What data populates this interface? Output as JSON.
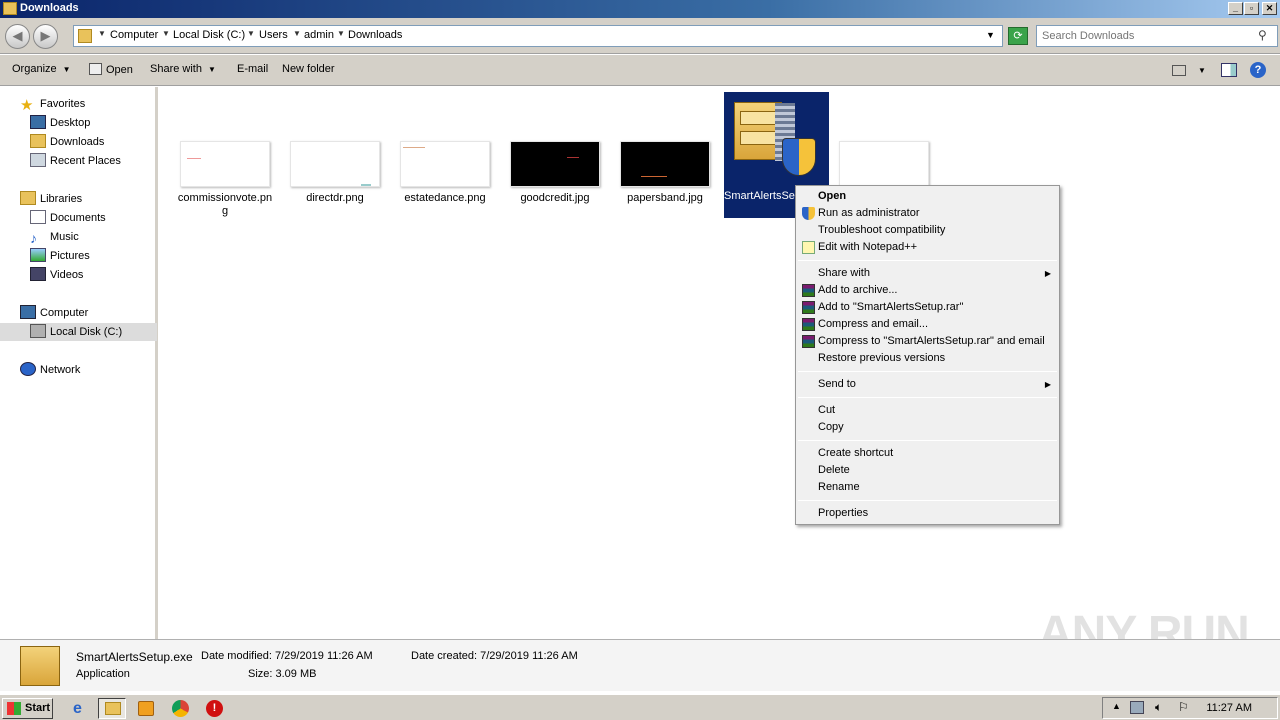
{
  "window": {
    "title": "Downloads"
  },
  "address": {
    "crumbs": [
      "Computer",
      "Local Disk (C:)",
      "Users",
      "admin",
      "Downloads"
    ],
    "search_placeholder": "Search Downloads"
  },
  "toolbar": {
    "organize": "Organize",
    "open": "Open",
    "share_with": "Share with",
    "email": "E-mail",
    "new_folder": "New folder"
  },
  "nav": {
    "favorites": "Favorites",
    "desktop": "Desktop",
    "downloads": "Downloads",
    "recent_places": "Recent Places",
    "libraries": "Libraries",
    "documents": "Documents",
    "music": "Music",
    "pictures": "Pictures",
    "videos": "Videos",
    "computer": "Computer",
    "local_disk": "Local Disk (C:)",
    "network": "Network"
  },
  "files": [
    {
      "name": "commissionvote.png"
    },
    {
      "name": "directdr.png"
    },
    {
      "name": "estatedance.png"
    },
    {
      "name": "goodcredit.jpg"
    },
    {
      "name": "papersband.jpg"
    }
  ],
  "selected_file": {
    "name": "SmartAlertsSetup.exe"
  },
  "context_menu": {
    "open": "Open",
    "run_as_admin": "Run as administrator",
    "troubleshoot": "Troubleshoot compatibility",
    "edit_notepad": "Edit with Notepad++",
    "share_with": "Share with",
    "add_archive": "Add to archive...",
    "add_rar": "Add to \"SmartAlertsSetup.rar\"",
    "compress_email": "Compress and email...",
    "compress_rar_email": "Compress to \"SmartAlertsSetup.rar\" and email",
    "restore": "Restore previous versions",
    "send_to": "Send to",
    "cut": "Cut",
    "copy": "Copy",
    "create_shortcut": "Create shortcut",
    "delete": "Delete",
    "rename": "Rename",
    "properties": "Properties"
  },
  "details": {
    "name": "SmartAlertsSetup.exe",
    "type": "Application",
    "date_modified": "Date modified: 7/29/2019 11:26 AM",
    "date_created": "Date created: 7/29/2019 11:26 AM",
    "size": "Size: 3.09 MB"
  },
  "taskbar": {
    "start": "Start",
    "clock": "11:27 AM"
  },
  "watermark": "ANY RUN"
}
